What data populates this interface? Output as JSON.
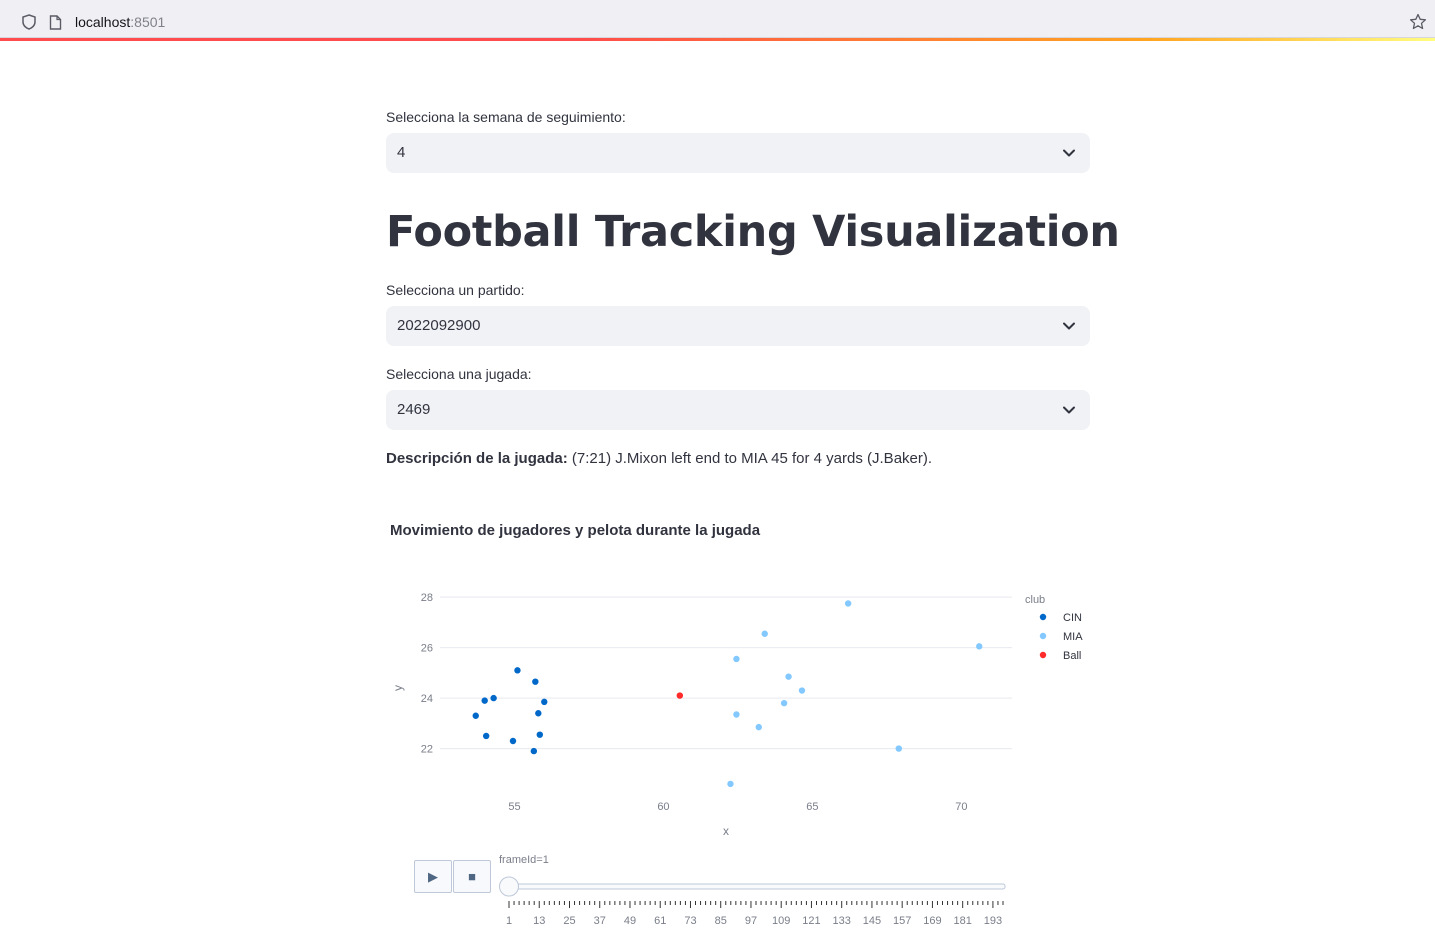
{
  "browser": {
    "url_host": "localhost",
    "url_port": ":8501"
  },
  "week_select": {
    "label": "Selecciona la semana de seguimiento:",
    "value": "4"
  },
  "title": "Football Tracking Visualization",
  "game_select": {
    "label": "Selecciona un partido:",
    "value": "2022092900"
  },
  "play_select": {
    "label": "Selecciona una jugada:",
    "value": "2469"
  },
  "description": {
    "label": "Descripción de la jugada:",
    "text": " (7:21) J.Mixon left end to MIA 45 for 4 yards (J.Baker)."
  },
  "chart_title": "Movimiento de jugadores y pelota durante la jugada",
  "chart_data": {
    "type": "scatter",
    "xlabel": "x",
    "ylabel": "y",
    "xlim": [
      52.5,
      71.7
    ],
    "ylim": [
      20.2,
      28.6
    ],
    "xticks": [
      55,
      60,
      65,
      70
    ],
    "yticks": [
      22,
      24,
      26,
      28
    ],
    "legend_title": "club",
    "legend_position": "right",
    "series": [
      {
        "name": "CIN",
        "color": "#0068c9",
        "points": [
          [
            55.1,
            25.1
          ],
          [
            55.7,
            24.65
          ],
          [
            54.3,
            24.0
          ],
          [
            54.0,
            23.9
          ],
          [
            56.0,
            23.85
          ],
          [
            55.8,
            23.4
          ],
          [
            53.7,
            23.3
          ],
          [
            55.85,
            22.55
          ],
          [
            54.05,
            22.5
          ],
          [
            54.95,
            22.3
          ],
          [
            55.65,
            21.9
          ]
        ]
      },
      {
        "name": "MIA",
        "color": "#83c9ff",
        "points": [
          [
            66.2,
            27.75
          ],
          [
            63.4,
            26.55
          ],
          [
            70.6,
            26.05
          ],
          [
            62.45,
            25.55
          ],
          [
            64.2,
            24.85
          ],
          [
            64.65,
            24.3
          ],
          [
            64.05,
            23.8
          ],
          [
            62.45,
            23.35
          ],
          [
            63.2,
            22.85
          ],
          [
            67.9,
            22.0
          ],
          [
            62.25,
            20.6
          ]
        ]
      },
      {
        "name": "Ball",
        "color": "#ff2b2b",
        "points": [
          [
            60.55,
            24.1
          ]
        ]
      }
    ]
  },
  "animation": {
    "play_label": "▶",
    "stop_label": "■",
    "frame_label": "frameId=1",
    "current_frame": 1,
    "min_frame": 1,
    "max_frame": 197,
    "tick_labels": [
      "1",
      "13",
      "25",
      "37",
      "49",
      "61",
      "73",
      "85",
      "97",
      "109",
      "121",
      "133",
      "145",
      "157",
      "169",
      "181",
      "193"
    ]
  }
}
